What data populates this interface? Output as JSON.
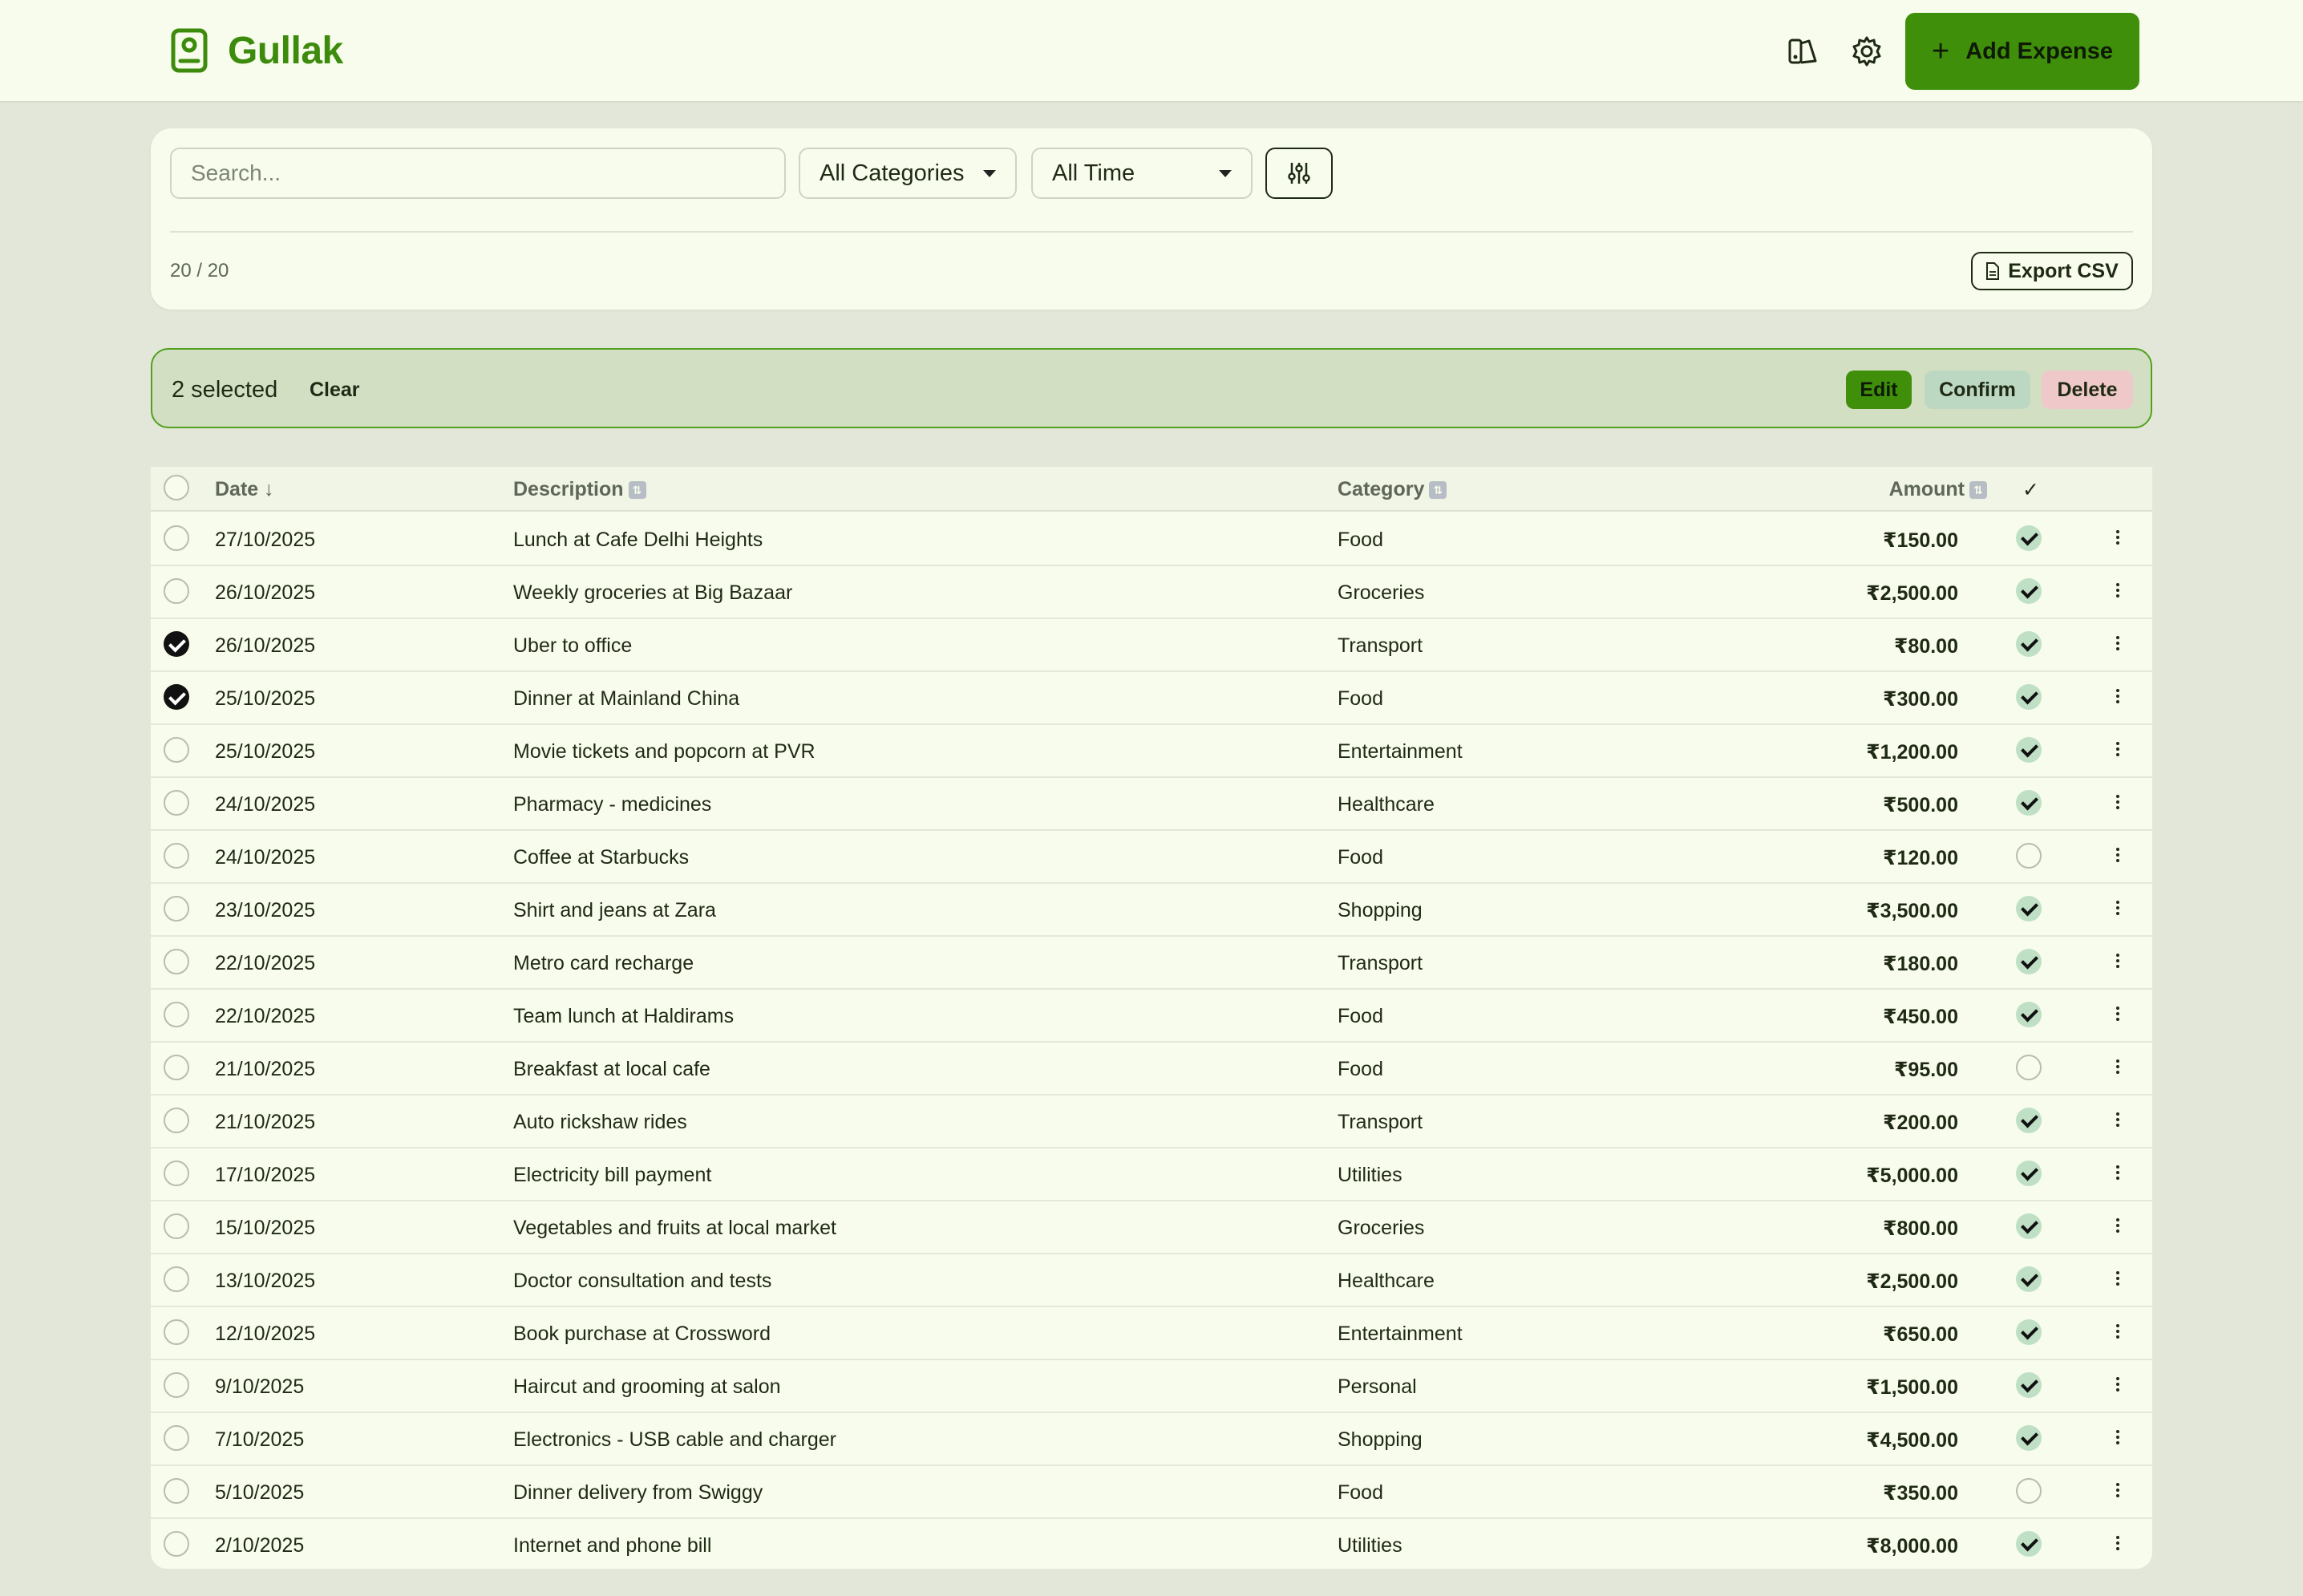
{
  "app": {
    "name": "Gullak"
  },
  "header": {
    "add_expense_label": "Add Expense"
  },
  "filters": {
    "search_placeholder": "Search...",
    "search_value": "",
    "category_selected": "All Categories",
    "time_selected": "All Time",
    "result_count": "20 / 20",
    "export_label": "Export CSV"
  },
  "selection": {
    "count_label": "2 selected",
    "clear_label": "Clear",
    "edit_label": "Edit",
    "confirm_label": "Confirm",
    "delete_label": "Delete"
  },
  "table": {
    "headers": {
      "date": "Date ↓",
      "description": "Description",
      "category": "Category",
      "amount": "Amount",
      "confirmed": "✓"
    },
    "rows": [
      {
        "date": "27/10/2025",
        "description": "Lunch at Cafe Delhi Heights",
        "category": "Food",
        "amount": "₹150.00",
        "selected": false,
        "confirmed": true
      },
      {
        "date": "26/10/2025",
        "description": "Weekly groceries at Big Bazaar",
        "category": "Groceries",
        "amount": "₹2,500.00",
        "selected": false,
        "confirmed": true
      },
      {
        "date": "26/10/2025",
        "description": "Uber to office",
        "category": "Transport",
        "amount": "₹80.00",
        "selected": true,
        "confirmed": true
      },
      {
        "date": "25/10/2025",
        "description": "Dinner at Mainland China",
        "category": "Food",
        "amount": "₹300.00",
        "selected": true,
        "confirmed": true
      },
      {
        "date": "25/10/2025",
        "description": "Movie tickets and popcorn at PVR",
        "category": "Entertainment",
        "amount": "₹1,200.00",
        "selected": false,
        "confirmed": true
      },
      {
        "date": "24/10/2025",
        "description": "Pharmacy - medicines",
        "category": "Healthcare",
        "amount": "₹500.00",
        "selected": false,
        "confirmed": true
      },
      {
        "date": "24/10/2025",
        "description": "Coffee at Starbucks",
        "category": "Food",
        "amount": "₹120.00",
        "selected": false,
        "confirmed": false
      },
      {
        "date": "23/10/2025",
        "description": "Shirt and jeans at Zara",
        "category": "Shopping",
        "amount": "₹3,500.00",
        "selected": false,
        "confirmed": true
      },
      {
        "date": "22/10/2025",
        "description": "Metro card recharge",
        "category": "Transport",
        "amount": "₹180.00",
        "selected": false,
        "confirmed": true
      },
      {
        "date": "22/10/2025",
        "description": "Team lunch at Haldirams",
        "category": "Food",
        "amount": "₹450.00",
        "selected": false,
        "confirmed": true
      },
      {
        "date": "21/10/2025",
        "description": "Breakfast at local cafe",
        "category": "Food",
        "amount": "₹95.00",
        "selected": false,
        "confirmed": false
      },
      {
        "date": "21/10/2025",
        "description": "Auto rickshaw rides",
        "category": "Transport",
        "amount": "₹200.00",
        "selected": false,
        "confirmed": true
      },
      {
        "date": "17/10/2025",
        "description": "Electricity bill payment",
        "category": "Utilities",
        "amount": "₹5,000.00",
        "selected": false,
        "confirmed": true
      },
      {
        "date": "15/10/2025",
        "description": "Vegetables and fruits at local market",
        "category": "Groceries",
        "amount": "₹800.00",
        "selected": false,
        "confirmed": true
      },
      {
        "date": "13/10/2025",
        "description": "Doctor consultation and tests",
        "category": "Healthcare",
        "amount": "₹2,500.00",
        "selected": false,
        "confirmed": true
      },
      {
        "date": "12/10/2025",
        "description": "Book purchase at Crossword",
        "category": "Entertainment",
        "amount": "₹650.00",
        "selected": false,
        "confirmed": true
      },
      {
        "date": "9/10/2025",
        "description": "Haircut and grooming at salon",
        "category": "Personal",
        "amount": "₹1,500.00",
        "selected": false,
        "confirmed": true
      },
      {
        "date": "7/10/2025",
        "description": "Electronics - USB cable and charger",
        "category": "Shopping",
        "amount": "₹4,500.00",
        "selected": false,
        "confirmed": true
      },
      {
        "date": "5/10/2025",
        "description": "Dinner delivery from Swiggy",
        "category": "Food",
        "amount": "₹350.00",
        "selected": false,
        "confirmed": false
      },
      {
        "date": "2/10/2025",
        "description": "Internet and phone bill",
        "category": "Utilities",
        "amount": "₹8,000.00",
        "selected": false,
        "confirmed": true
      }
    ]
  },
  "colors": {
    "accent": "#3f8f0b",
    "brand": "#3d8b0d",
    "confirm_bg": "#bdd8c2",
    "delete_bg": "#efc9c9",
    "selection_bg": "#d2dfc3"
  }
}
